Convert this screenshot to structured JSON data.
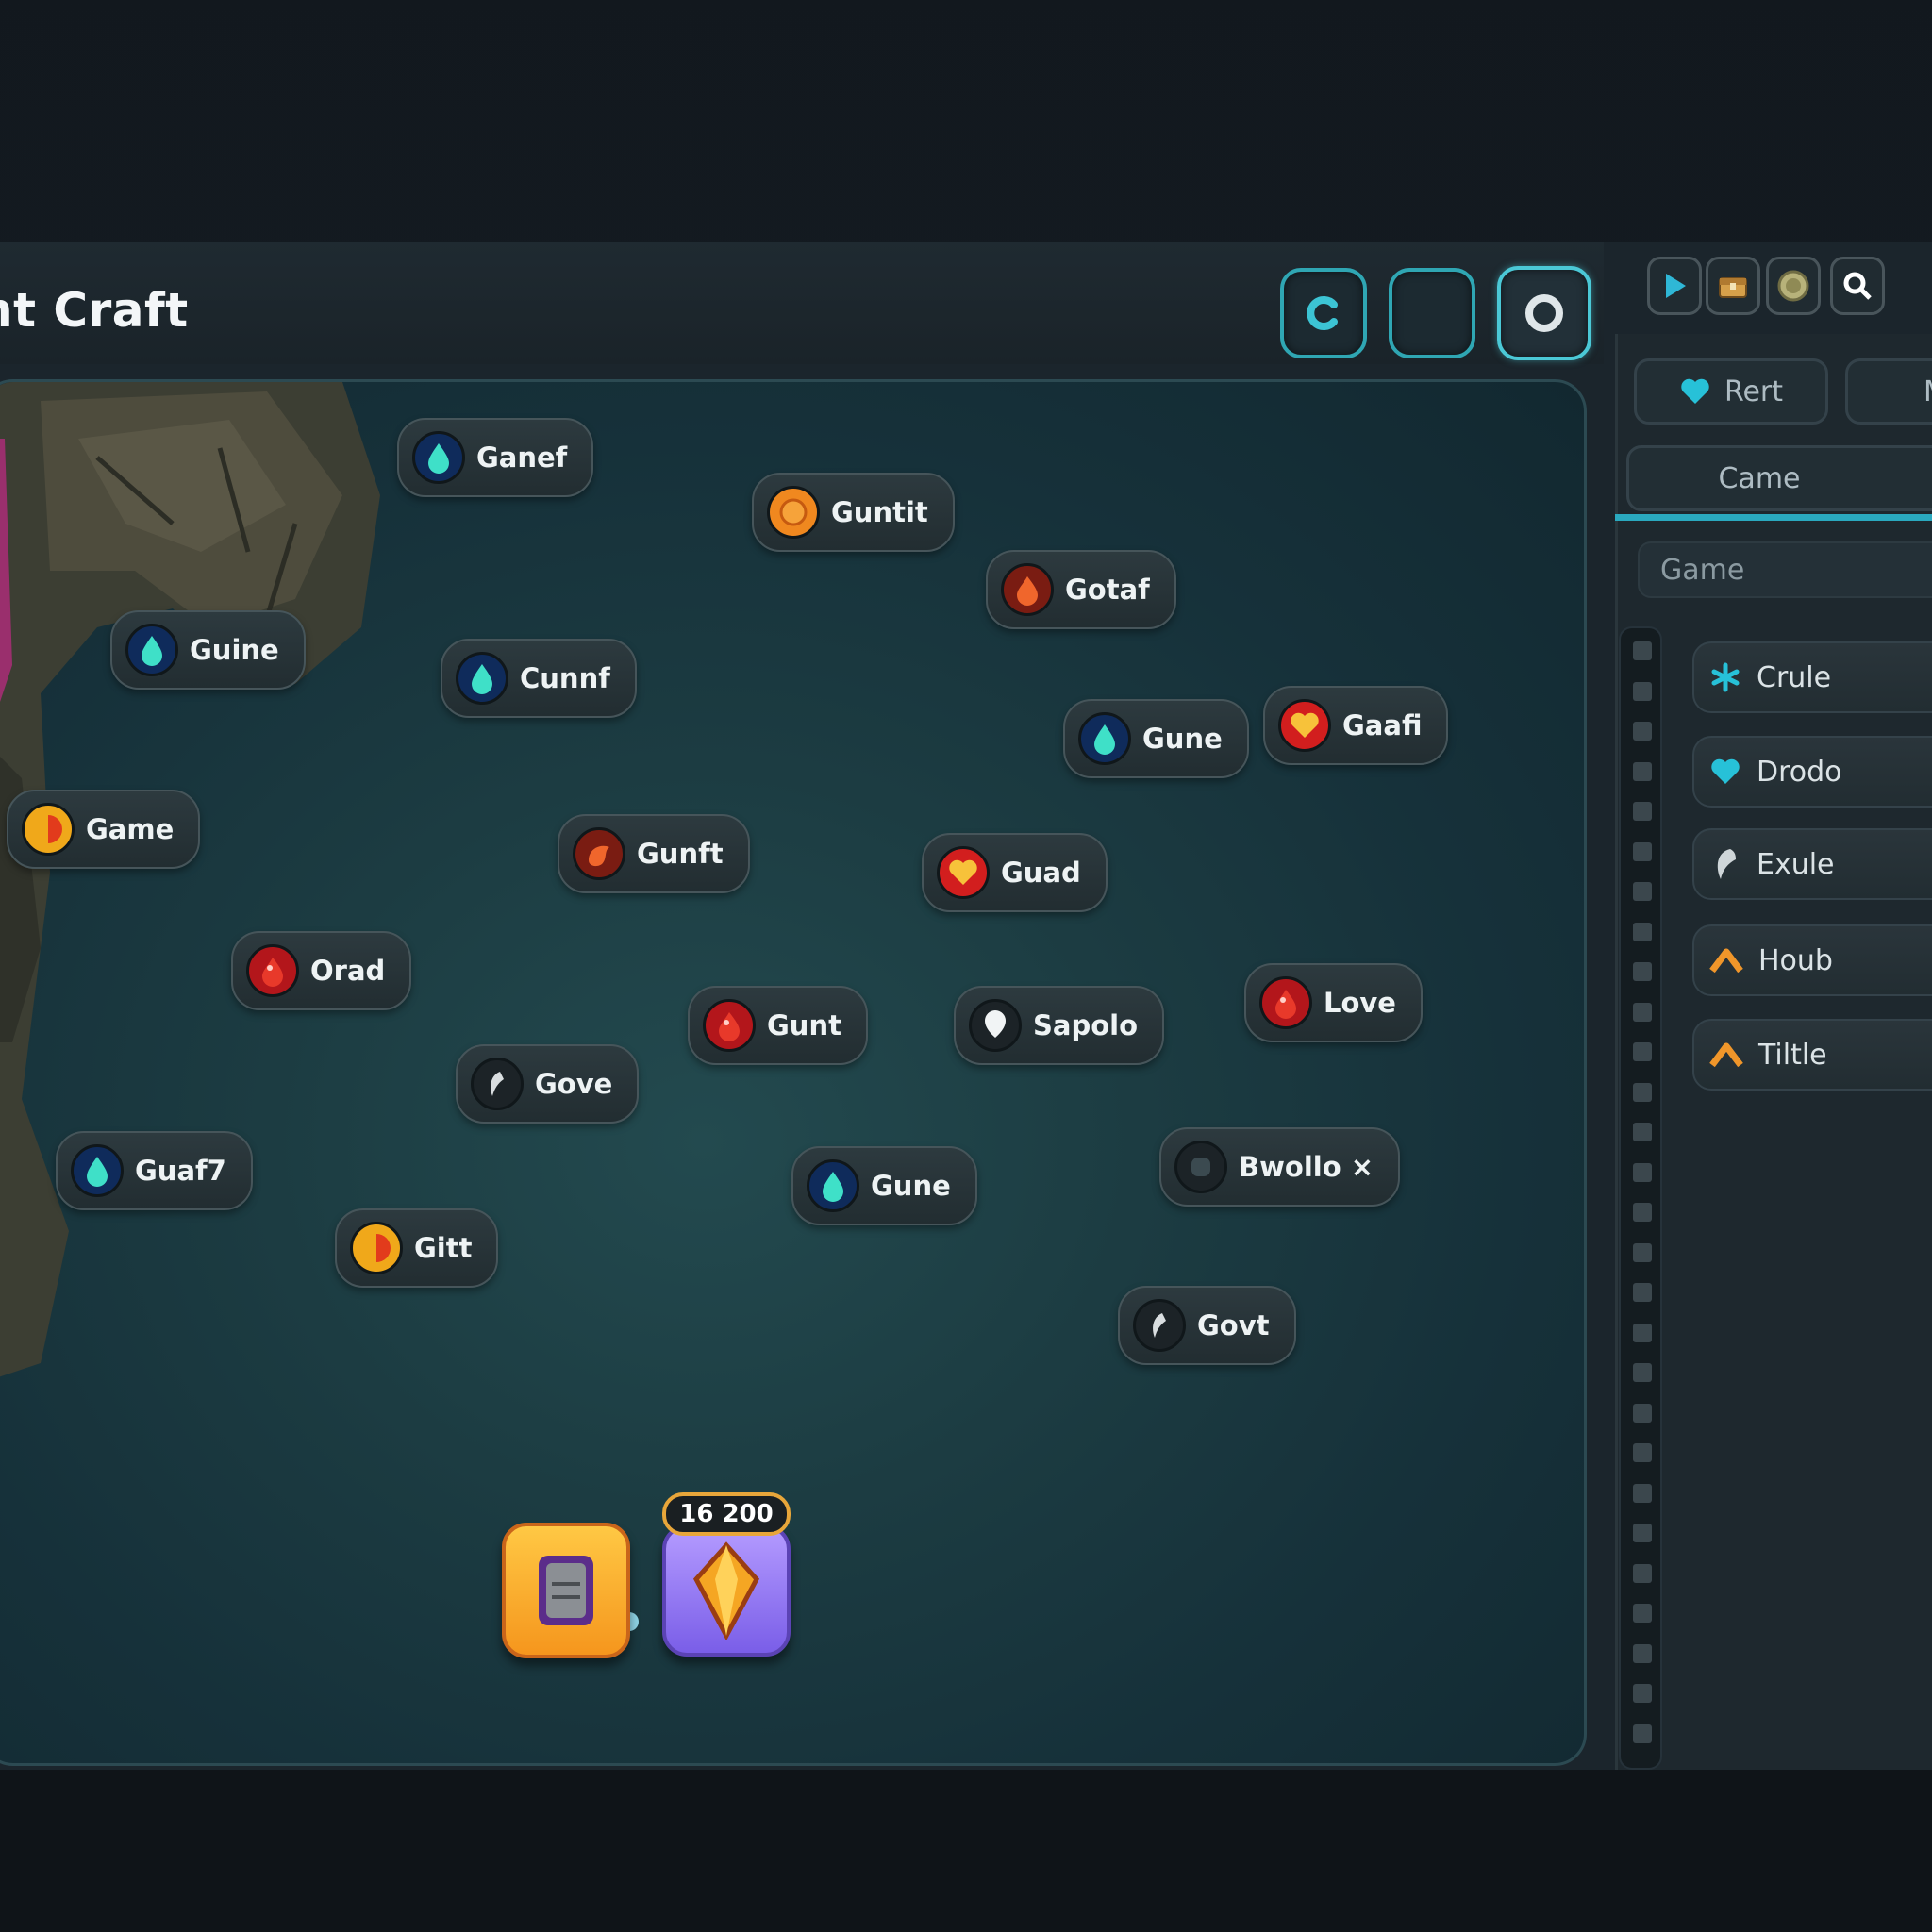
{
  "window": {
    "title": "nt Craft"
  },
  "top_buttons": [
    {
      "name": "refresh",
      "icon": "refresh-icon"
    },
    {
      "name": "night",
      "icon": "moon-icon"
    },
    {
      "name": "record",
      "icon": "ring-icon"
    }
  ],
  "toolbar": [
    {
      "icon": "play-icon"
    },
    {
      "icon": "chest-icon"
    },
    {
      "icon": "coin-icon"
    },
    {
      "icon": "search-icon"
    }
  ],
  "elements": [
    {
      "label": "Ganef",
      "icon": "water-drop-icon"
    },
    {
      "label": "Guntit",
      "icon": "sun-icon"
    },
    {
      "label": "Gotaf",
      "icon": "fire-icon"
    },
    {
      "label": "Guine",
      "icon": "water-drop-icon"
    },
    {
      "label": "Cunnf",
      "icon": "water-drop-icon"
    },
    {
      "label": "Gune",
      "icon": "water-drop-icon"
    },
    {
      "label": "Gaafi",
      "icon": "heart-icon"
    },
    {
      "label": "Game",
      "icon": "flame-half-icon"
    },
    {
      "label": "Gunft",
      "icon": "fire-icon"
    },
    {
      "label": "Guad",
      "icon": "heart-icon"
    },
    {
      "label": "Orad",
      "icon": "blood-drop-icon"
    },
    {
      "label": "Gunt",
      "icon": "blood-drop-icon"
    },
    {
      "label": "Sapolo",
      "icon": "white-drop-icon"
    },
    {
      "label": "Love",
      "icon": "blood-drop-icon"
    },
    {
      "label": "Gove",
      "icon": "wind-icon"
    },
    {
      "label": "Guaf7",
      "icon": "water-drop-icon"
    },
    {
      "label": "Gune",
      "icon": "water-drop-icon"
    },
    {
      "label": "Bwollo ×",
      "icon": "stone-icon"
    },
    {
      "label": "Gitt",
      "icon": "flame-half-icon"
    },
    {
      "label": "Govt",
      "icon": "wind-icon"
    }
  ],
  "inventory": {
    "counter": "16 200"
  },
  "panel": {
    "tabs": [
      {
        "label": "Rert"
      },
      {
        "label": "M"
      }
    ],
    "section": "Came",
    "search_placeholder": "Game",
    "items": [
      {
        "label": "Crule",
        "icon": "sparkle-icon"
      },
      {
        "label": "Drodo",
        "icon": "heart-icon"
      },
      {
        "label": "Exule",
        "icon": "feather-icon"
      },
      {
        "label": "Houb",
        "icon": "chevron-up-icon"
      },
      {
        "label": "Tiltle",
        "icon": "chevron-up-icon"
      }
    ]
  },
  "colors": {
    "accent": "#2fa6b3",
    "gold": "#f5a623",
    "violet": "#8b6cf2"
  }
}
